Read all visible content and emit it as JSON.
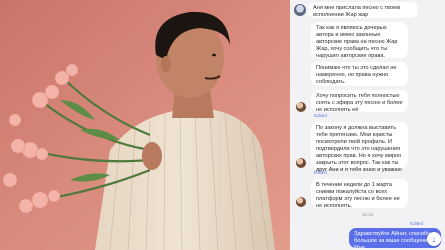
{
  "chat": {
    "messages": [
      {
        "side": "left",
        "text": "Аня мне прислала песню с твоем исполнении Жар жар",
        "edited": ""
      },
      {
        "side": "left",
        "text": "Так как я являюсь дочерью автора и имею законные авторские права на песню Жар Жар, хочу сообщить что ты нарушил авторские права.",
        "edited": ""
      },
      {
        "side": "left",
        "text": "Понимаю что ты это сделал не намеренно, но права нужно соблюдать.",
        "edited": ""
      },
      {
        "side": "left",
        "text": "Хочу попросить тебя полностью снять с эфира эту песню и более не исполнять её",
        "edited": "Edited"
      },
      {
        "side": "left",
        "text": "По закону я должна выставить тебе претензию. Мои юристы посмотрели твой профиль. И подтвердили что это нарушения авторских прав. Но я хочу мирно закрыть этот вопрос. Так как ты друг Ани и я тебя знаю и уважаю",
        "edited": "Edited"
      },
      {
        "side": "left",
        "text": "В течении недели до 1 марта снимки пожалуйста со всех платформ эту песню и более ее не исполнять.",
        "edited": ""
      }
    ],
    "timestamp": "18:33",
    "sent": {
      "text": "Здравствуйте Айнат, спасибо большое за ваше сообщение! Мне",
      "edited": "Edited"
    }
  },
  "icons": {
    "scroll_down": "arrow-down-icon"
  },
  "colors": {
    "accent": "#5b6fe8",
    "photo_bg": "#d8897d",
    "edited": "#5b79d6"
  }
}
